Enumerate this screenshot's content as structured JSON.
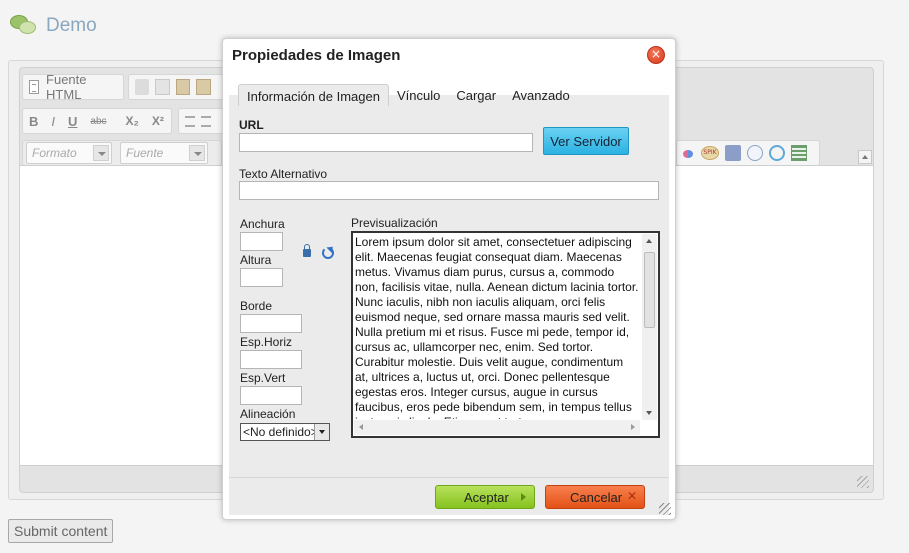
{
  "page": {
    "title": "Demo"
  },
  "editor_toolbar": {
    "source_label": "Fuente HTML",
    "format_combo": "Formato",
    "font_combo": "Fuente",
    "bold": "B",
    "italic": "I",
    "underline": "U",
    "strike": "abc",
    "subscript": "X₂",
    "superscript": "X²"
  },
  "submit": {
    "label": "Submit content"
  },
  "dialog": {
    "title": "Propiedades de Imagen",
    "tabs": [
      {
        "label": "Información de Imagen",
        "active": true
      },
      {
        "label": "Vínculo",
        "active": false
      },
      {
        "label": "Cargar",
        "active": false
      },
      {
        "label": "Avanzado",
        "active": false
      }
    ],
    "url_label": "URL",
    "url_value": "",
    "browse_button": "Ver Servidor",
    "alt_label": "Texto Alternativo",
    "alt_value": "",
    "width_label": "Anchura",
    "height_label": "Altura",
    "border_label": "Borde",
    "hspace_label": "Esp.Horiz",
    "vspace_label": "Esp.Vert",
    "align_label": "Alineación",
    "align_selected": "<No definido>",
    "preview_label": "Previsualización",
    "preview_text": "Lorem ipsum dolor sit amet, consectetuer adipiscing elit. Maecenas feugiat consequat diam. Maecenas metus. Vivamus diam purus, cursus a, commodo non, facilisis vitae, nulla. Aenean dictum lacinia tortor. Nunc iaculis, nibh non iaculis aliquam, orci felis euismod neque, sed ornare massa mauris sed velit. Nulla pretium mi et risus. Fusce mi pede, tempor id, cursus ac, ullamcorper nec, enim. Sed tortor. Curabitur molestie. Duis velit augue, condimentum at, ultrices a, luctus ut, orci. Donec pellentesque egestas eros. Integer cursus, augue in cursus faucibus, eros pede bibendum sem, in tempus tellus justo quis ligula. Etiam eget tortor.",
    "ok_button": "Aceptar",
    "cancel_button": "Cancelar"
  },
  "colors": {
    "title_blue": "#8aa7c0",
    "ok_green": "#86c21f",
    "cancel_orange": "#e35216",
    "browse_cyan": "#2bb2e2",
    "close_red": "#d9361a"
  }
}
